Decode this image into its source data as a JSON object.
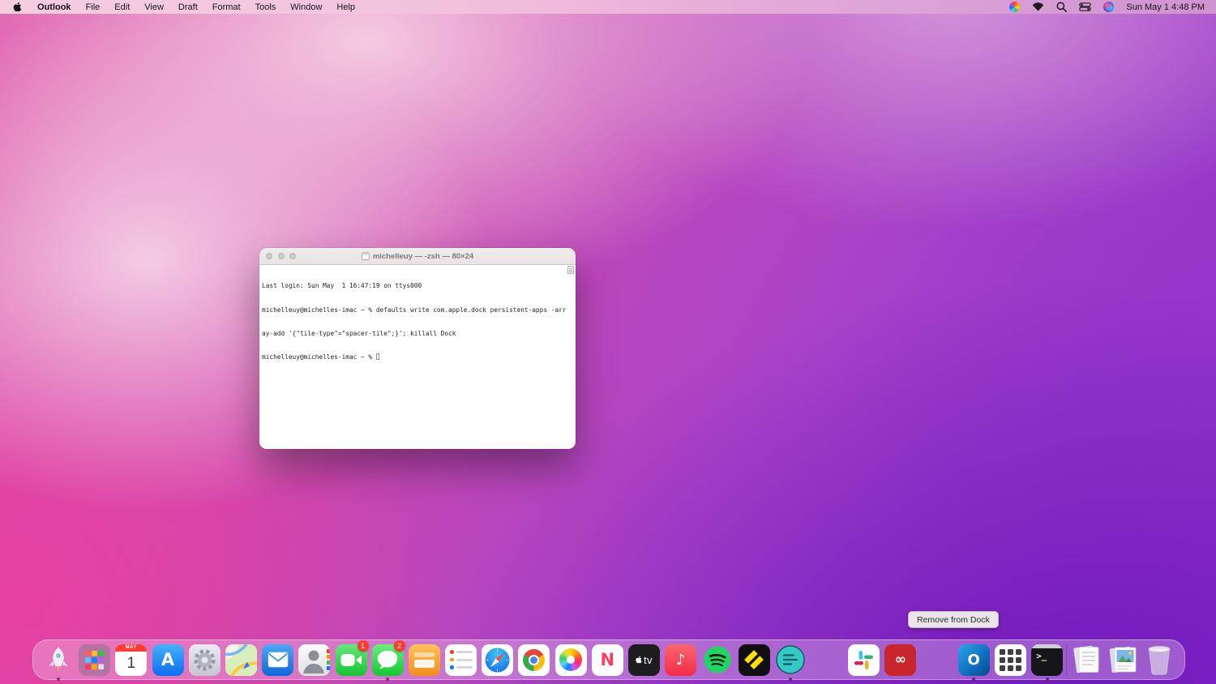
{
  "menubar": {
    "app_name": "Outlook",
    "items": [
      "File",
      "Edit",
      "View",
      "Draft",
      "Format",
      "Tools",
      "Window",
      "Help"
    ],
    "status_icons": [
      "color-wheel",
      "wifi",
      "spotlight-search",
      "control-center",
      "siri"
    ],
    "clock": "Sun May 1 4:48 PM"
  },
  "terminal": {
    "title": "michelleuy — -zsh — 80×24",
    "lines": [
      "Last login: Sun May  1 16:47:19 on ttys000",
      "michelleuy@michelles-imac ~ % defaults write com.apple.dock persistent-apps -arr",
      "ay-add '{\"tile-type\"=\"spacer-tile\";}'; killall Dock",
      "michelleuy@michelles-imac ~ % "
    ]
  },
  "tooltip": {
    "text": "Remove from Dock"
  },
  "colors": {
    "badge_red": "#ff3b30",
    "calendar_red": "#ff3b30",
    "spotify_green": "#1ed760",
    "outlook_blue": "#0f6cbd"
  },
  "dock": {
    "items": [
      {
        "id": "rocket",
        "label": "Rocket",
        "running": true
      },
      {
        "id": "launchpad",
        "label": "Launchpad"
      },
      {
        "id": "calendar",
        "label": "Calendar",
        "cal_month": "MAY",
        "cal_day": "1"
      },
      {
        "id": "appstore",
        "label": "App Store",
        "glyph": "A"
      },
      {
        "id": "settings",
        "label": "System Preferences"
      },
      {
        "id": "maps",
        "label": "Maps"
      },
      {
        "id": "mail",
        "label": "Mail"
      },
      {
        "id": "contacts",
        "label": "Contacts"
      },
      {
        "id": "facetime",
        "label": "FaceTime",
        "badge": "1"
      },
      {
        "id": "messages",
        "label": "Messages",
        "badge": "2",
        "running": true
      },
      {
        "id": "orangeapp",
        "label": "Orange Wallet App"
      },
      {
        "id": "reminders",
        "label": "Reminders"
      },
      {
        "id": "safari",
        "label": "Safari"
      },
      {
        "id": "chrome",
        "label": "Google Chrome"
      },
      {
        "id": "photos",
        "label": "Photos"
      },
      {
        "id": "news",
        "label": "News",
        "glyph": "N"
      },
      {
        "id": "appletv",
        "label": "Apple TV",
        "glyph": "tv"
      },
      {
        "id": "music",
        "label": "Music",
        "glyph": "♪"
      },
      {
        "id": "spotify",
        "label": "Spotify"
      },
      {
        "id": "yellowapp",
        "label": "Yellow Diamond App"
      },
      {
        "id": "tealapp",
        "label": "Teal Circle App",
        "running": true
      },
      {
        "id": "spacer1",
        "spacer": true
      },
      {
        "id": "slack",
        "label": "Slack"
      },
      {
        "id": "adobecc",
        "label": "Adobe Creative Cloud",
        "glyph": "∞"
      },
      {
        "id": "spacer2",
        "spacer": true
      },
      {
        "id": "outlook",
        "label": "Microsoft Outlook",
        "glyph": "O",
        "running": true
      },
      {
        "id": "gridapp",
        "label": "Grid App"
      },
      {
        "id": "terminalapp",
        "label": "Terminal",
        "glyph": "&gt;_",
        "glyph_text": ">_",
        "running": true
      },
      {
        "id": "separator",
        "separator": true
      },
      {
        "id": "docstack",
        "label": "Documents Stack"
      },
      {
        "id": "mediastack",
        "label": "Media Stack"
      },
      {
        "id": "trash",
        "label": "Trash"
      }
    ]
  }
}
